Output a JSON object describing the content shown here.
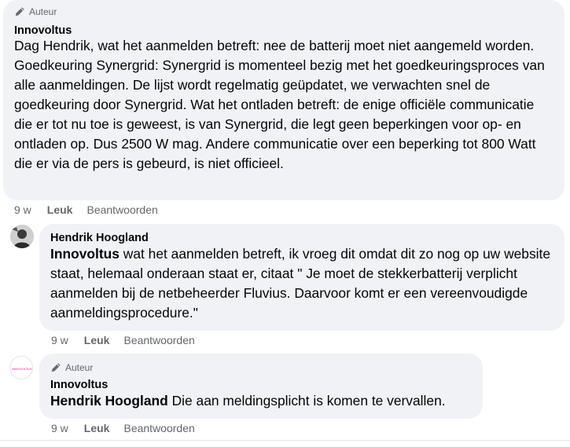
{
  "comments": [
    {
      "badge": "Auteur",
      "author": "Innovoltus",
      "text": "Dag Hendrik, wat het aanmelden betreft: nee de batterij moet niet aangemeld worden. Goedkeuring Synergrid: Synergrid is momenteel bezig met het goedkeuringsproces van alle aanmeldingen. De lijst wordt regelmatig geüpdatet, we verwachten snel de goedkeuring door Synergrid. Wat het ontladen betreft: de enige officiële communicatie die er tot nu toe is geweest, is van Synergrid, die legt geen beperkingen voor op- en ontladen op. Dus 2500 W mag. Andere communicatie over een beperking tot 800 Watt die er via de pers is gebeurd, is niet officieel.",
      "time": "9 w",
      "like": "Leuk",
      "reply": "Beantwoorden"
    },
    {
      "author": "Hendrik Hoogland",
      "mention": "Innovoltus",
      "text": " wat het aanmelden betreft, ik vroeg dit omdat dit zo nog op uw website staat, helemaal onderaan staat er, citaat \" Je moet de stekkerbatterij verplicht aanmelden bij de netbeheerder Fluvius. Daarvoor komt er een vereenvoudigde aanmeldingsprocedure.\"",
      "time": "9 w",
      "like": "Leuk",
      "reply": "Beantwoorden"
    },
    {
      "badge": "Auteur",
      "author": "Innovoltus",
      "mention": "Hendrik Hoogland",
      "text": " Die aan meldingsplicht is komen te vervallen.",
      "avatar_label": "INNOVOLTUS",
      "time": "9 w",
      "like": "Leuk",
      "reply": "Beantwoorden"
    }
  ],
  "colors": {
    "bubble": "#f0f2f5",
    "secondary_text": "#65676b",
    "brand_pink": "#e0218a"
  }
}
